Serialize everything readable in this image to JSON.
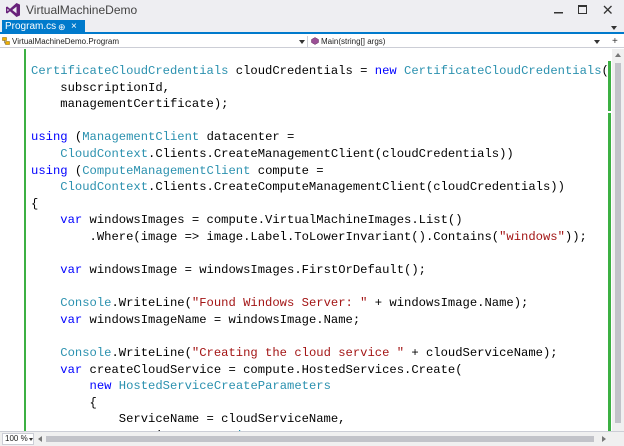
{
  "window": {
    "title": "VirtualMachineDemo",
    "minimize": "minimize-icon",
    "maximize": "maximize-icon",
    "close": "close-icon"
  },
  "tabs": [
    {
      "label": "Program.cs",
      "pin_icon": "pin-icon",
      "close_label": "×"
    }
  ],
  "navbar": {
    "type_combo": "VirtualMachineDemo.Program",
    "member_combo": "Main(string[] args)",
    "add_label": "+"
  },
  "editor": {
    "lines": [
      [
        {
          "t": "CertificateCloudCredentials",
          "c": "ty"
        },
        {
          "t": " cloudCredentials = "
        },
        {
          "t": "new",
          "c": "kw"
        },
        {
          "t": " "
        },
        {
          "t": "CertificateCloudCredentials",
          "c": "ty"
        },
        {
          "t": "("
        }
      ],
      [
        {
          "t": "    subscriptionId,"
        }
      ],
      [
        {
          "t": "    managementCertificate);"
        }
      ],
      [
        {
          "t": ""
        }
      ],
      [
        {
          "t": "using",
          "c": "kw"
        },
        {
          "t": " ("
        },
        {
          "t": "ManagementClient",
          "c": "ty"
        },
        {
          "t": " datacenter ="
        }
      ],
      [
        {
          "t": "    "
        },
        {
          "t": "CloudContext",
          "c": "ty"
        },
        {
          "t": ".Clients.CreateManagementClient(cloudCredentials))"
        }
      ],
      [
        {
          "t": "using",
          "c": "kw"
        },
        {
          "t": " ("
        },
        {
          "t": "ComputeManagementClient",
          "c": "ty"
        },
        {
          "t": " compute ="
        }
      ],
      [
        {
          "t": "    "
        },
        {
          "t": "CloudContext",
          "c": "ty"
        },
        {
          "t": ".Clients.CreateComputeManagementClient(cloudCredentials))"
        }
      ],
      [
        {
          "t": "{"
        }
      ],
      [
        {
          "t": "    "
        },
        {
          "t": "var",
          "c": "kw"
        },
        {
          "t": " windowsImages = compute.VirtualMachineImages.List()"
        }
      ],
      [
        {
          "t": "        .Where(image => image.Label.ToLowerInvariant().Contains("
        },
        {
          "t": "\"windows\"",
          "c": "st"
        },
        {
          "t": "));"
        }
      ],
      [
        {
          "t": ""
        }
      ],
      [
        {
          "t": "    "
        },
        {
          "t": "var",
          "c": "kw"
        },
        {
          "t": " windowsImage = windowsImages.FirstOrDefault();"
        }
      ],
      [
        {
          "t": ""
        }
      ],
      [
        {
          "t": "    "
        },
        {
          "t": "Console",
          "c": "ty"
        },
        {
          "t": ".WriteLine("
        },
        {
          "t": "\"Found Windows Server: \"",
          "c": "st"
        },
        {
          "t": " + windowsImage.Name);"
        }
      ],
      [
        {
          "t": "    "
        },
        {
          "t": "var",
          "c": "kw"
        },
        {
          "t": " windowsImageName = windowsImage.Name;"
        }
      ],
      [
        {
          "t": ""
        }
      ],
      [
        {
          "t": "    "
        },
        {
          "t": "Console",
          "c": "ty"
        },
        {
          "t": ".WriteLine("
        },
        {
          "t": "\"Creating the cloud service \"",
          "c": "st"
        },
        {
          "t": " + cloudServiceName);"
        }
      ],
      [
        {
          "t": "    "
        },
        {
          "t": "var",
          "c": "kw"
        },
        {
          "t": " createCloudService = compute.HostedServices.Create("
        }
      ],
      [
        {
          "t": "        "
        },
        {
          "t": "new",
          "c": "kw"
        },
        {
          "t": " "
        },
        {
          "t": "HostedServiceCreateParameters",
          "c": "ty"
        }
      ],
      [
        {
          "t": "        {"
        }
      ],
      [
        {
          "t": "            ServiceName = cloudServiceName,"
        }
      ],
      [
        {
          "t": "            Location = "
        },
        {
          "t": "LocationNames",
          "c": "ty"
        },
        {
          "t": ".WestUS,"
        }
      ],
      [
        {
          "t": "        });"
        }
      ]
    ]
  },
  "statusbar": {
    "zoom": "100 %"
  },
  "colors": {
    "accent": "#007acc",
    "keyword": "#0000ff",
    "type": "#2b91af",
    "string": "#a31515",
    "change_marker": "#3cb043"
  }
}
